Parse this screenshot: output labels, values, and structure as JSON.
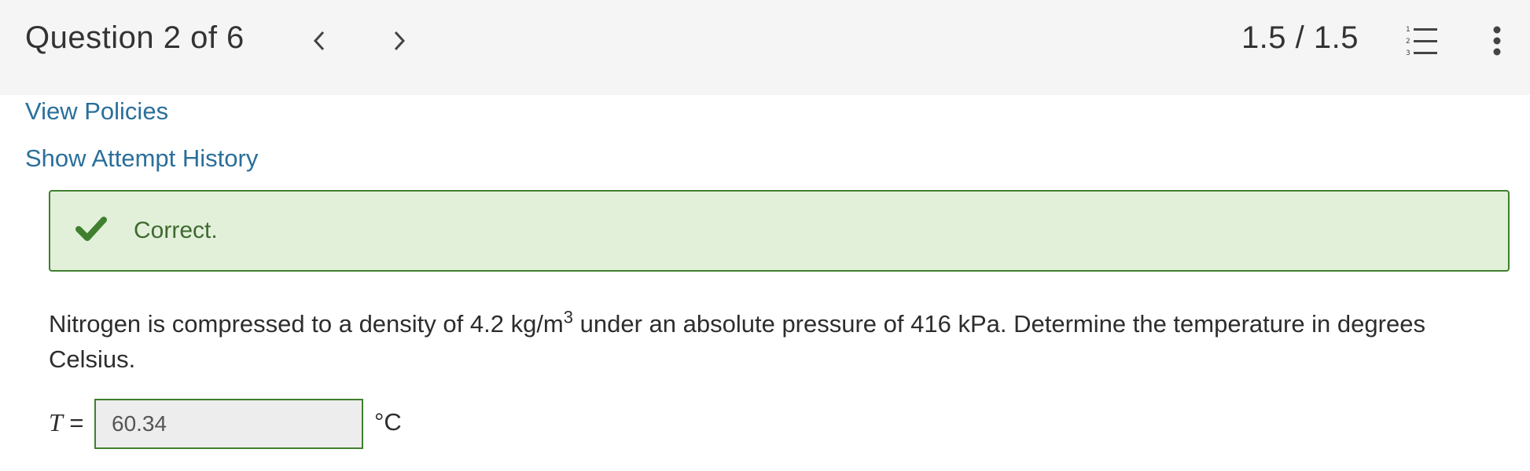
{
  "header": {
    "question_label": "Question 2 of 6",
    "score": "1.5 / 1.5",
    "prev_icon": "chevron-left-icon",
    "next_icon": "chevron-right-icon",
    "list_icon": "numbered-list-icon",
    "more_icon": "vertical-ellipsis-icon"
  },
  "links": {
    "view_policies": "View Policies",
    "attempt_history": "Show Attempt History"
  },
  "feedback": {
    "status": "Correct.",
    "icon": "checkmark-icon",
    "accent_color": "#3f7f2e",
    "background_color": "#e2f0da"
  },
  "question": {
    "text_before": "Nitrogen is compressed to a density of 4.2 kg/m",
    "superscript": "3",
    "text_after": " under an absolute pressure of 416 kPa. Determine the temperature in degrees Celsius."
  },
  "answer": {
    "variable": "T",
    "equals": " =",
    "value": "60.34",
    "unit": "°C"
  },
  "colors": {
    "link": "#2a6f9b",
    "header_background": "#f5f5f5"
  }
}
